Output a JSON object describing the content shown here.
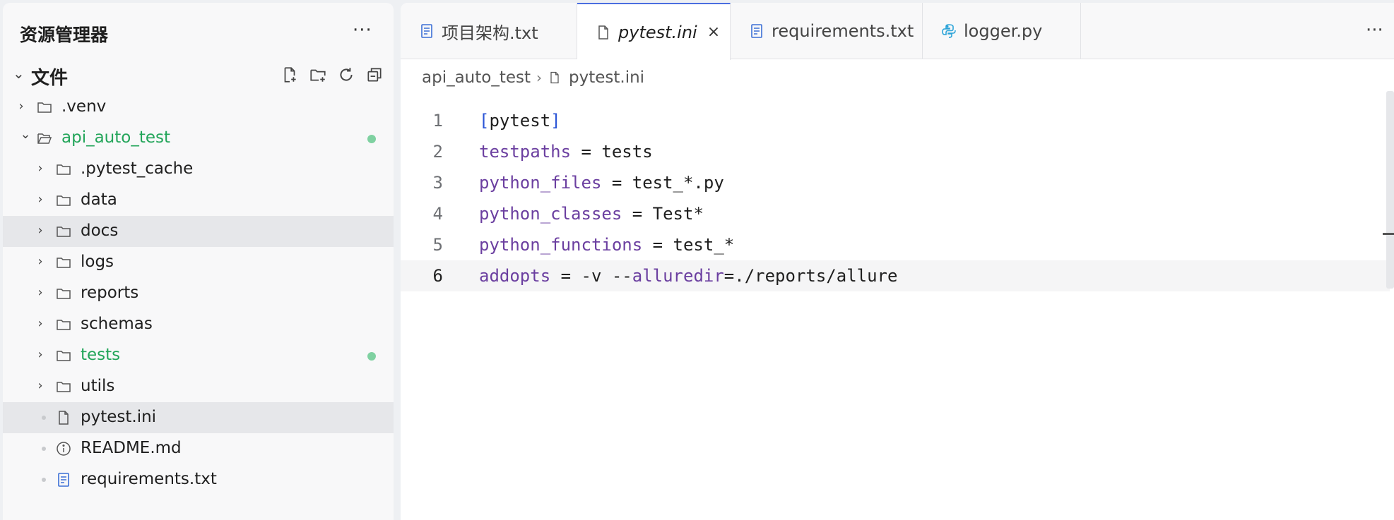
{
  "explorer": {
    "title": "资源管理器",
    "more": "···",
    "section": {
      "chevron": "⌄",
      "label": "文件",
      "actions": [
        "new-file-icon",
        "new-folder-icon",
        "refresh-icon",
        "collapse-all-icon"
      ]
    },
    "items": [
      {
        "name": ".venv",
        "type": "folder",
        "expanded": false,
        "depth": 0
      },
      {
        "name": "api_auto_test",
        "type": "folder",
        "expanded": true,
        "depth": 0,
        "modified": true
      },
      {
        "name": ".pytest_cache",
        "type": "folder",
        "expanded": false,
        "depth": 1
      },
      {
        "name": "data",
        "type": "folder",
        "expanded": false,
        "depth": 1
      },
      {
        "name": "docs",
        "type": "folder",
        "expanded": false,
        "depth": 1,
        "hovered": true
      },
      {
        "name": "logs",
        "type": "folder",
        "expanded": false,
        "depth": 1
      },
      {
        "name": "reports",
        "type": "folder",
        "expanded": false,
        "depth": 1
      },
      {
        "name": "schemas",
        "type": "folder",
        "expanded": false,
        "depth": 1
      },
      {
        "name": "tests",
        "type": "folder",
        "expanded": false,
        "depth": 1,
        "modified": true
      },
      {
        "name": "utils",
        "type": "folder",
        "expanded": false,
        "depth": 1
      },
      {
        "name": "pytest.ini",
        "type": "file",
        "depth": 1,
        "selected": true
      },
      {
        "name": "README.md",
        "type": "info",
        "depth": 1
      },
      {
        "name": "requirements.txt",
        "type": "text",
        "depth": 1
      }
    ]
  },
  "tabs": [
    {
      "label": "项目架构.txt",
      "icon": "text-file-icon"
    },
    {
      "label": "pytest.ini",
      "icon": "file-icon",
      "active": true,
      "close": "×"
    },
    {
      "label": "requirements.txt",
      "icon": "text-file-icon"
    },
    {
      "label": "logger.py",
      "icon": "python-icon"
    }
  ],
  "tab_more": "···",
  "breadcrumb": {
    "folder": "api_auto_test",
    "file": "pytest.ini"
  },
  "code": {
    "current_line": 6,
    "lines": [
      {
        "num": "1",
        "tokens": [
          {
            "t": "[",
            "c": "br"
          },
          {
            "t": "pytest",
            "c": ""
          },
          {
            "t": "]",
            "c": "br"
          }
        ]
      },
      {
        "num": "2",
        "tokens": [
          {
            "t": "testpaths",
            "c": "k"
          },
          {
            "t": " = tests",
            "c": ""
          }
        ]
      },
      {
        "num": "3",
        "tokens": [
          {
            "t": "python_files",
            "c": "k"
          },
          {
            "t": " = test_*.py",
            "c": ""
          }
        ]
      },
      {
        "num": "4",
        "tokens": [
          {
            "t": "python_classes",
            "c": "k"
          },
          {
            "t": " = Test*",
            "c": ""
          }
        ]
      },
      {
        "num": "5",
        "tokens": [
          {
            "t": "python_functions",
            "c": "k"
          },
          {
            "t": " = test_*",
            "c": ""
          }
        ]
      },
      {
        "num": "6",
        "tokens": [
          {
            "t": "addopts",
            "c": "k"
          },
          {
            "t": " = -v --",
            "c": ""
          },
          {
            "t": "alluredir",
            "c": "k"
          },
          {
            "t": "=./reports/allure",
            "c": ""
          }
        ]
      }
    ]
  },
  "colors": {
    "accent": "#4a6ee0",
    "modified": "#23a55a",
    "keyword": "#6b3fa0",
    "bracket": "#2b55d6"
  }
}
